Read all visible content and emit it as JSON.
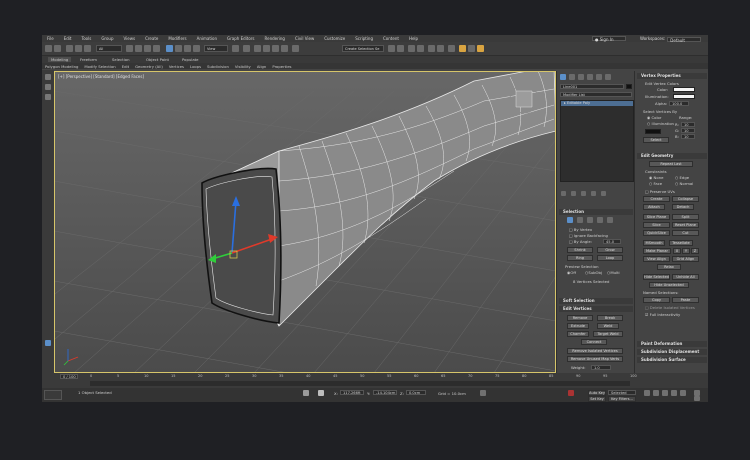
{
  "menu": [
    "File",
    "Edit",
    "Tools",
    "Group",
    "Views",
    "Create",
    "Modifiers",
    "Animation",
    "Graph Editors",
    "Rendering",
    "Civil View",
    "Customize",
    "Scripting",
    "Content",
    "Help"
  ],
  "signin": "Sign In",
  "workspaces": {
    "label": "Workspaces:",
    "value": "Default"
  },
  "toolbar": {
    "filter": "All",
    "view": "View",
    "selection_set": "Create Selection Se"
  },
  "ribbon_tabs": [
    "Modeling",
    "Freeform",
    "Selection",
    "Object Paint",
    "Populate"
  ],
  "ribbon_sub": [
    "Polygon Modeling",
    "Modify Selection",
    "Edit",
    "Geometry (All)",
    "Vertices",
    "Loops",
    "Subdivision",
    "Visibility",
    "Align",
    "Properties"
  ],
  "viewport": {
    "label": "[+] [Perspective] [Standard] [Edged Faces]"
  },
  "command_panel": {
    "object_name": "Line001",
    "modifier_list": "Modifier List",
    "modifier": "Editable Poly",
    "selection": {
      "title": "Selection",
      "by_vertex": "By Vertex",
      "ignore_backfacing": "Ignore Backfacing",
      "by_angle": "By Angle:",
      "by_angle_value": "45.0",
      "shrink": "Shrink",
      "grow": "Grow",
      "ring": "Ring",
      "loop": "Loop",
      "preview": "Preview Selection",
      "off": "Off",
      "subobj": "SubObj",
      "multi": "Multi",
      "status": "8 Vertices Selected"
    },
    "soft_selection": "Soft Selection",
    "edit_vertices": {
      "title": "Edit Vertices",
      "remove": "Remove",
      "break": "Break",
      "extrude": "Extrude",
      "weld": "Weld",
      "chamfer": "Chamfer",
      "target_weld": "Target Weld",
      "connect": "Connect",
      "remove_isolated": "Remove Isolated Vertices",
      "remove_unused": "Remove Unused Map Verts",
      "weight": "Weight:",
      "weight_value": "1.0",
      "crease": "Crease:",
      "crease_value": "0.0"
    }
  },
  "roll_panel": {
    "vertex_properties": {
      "title": "Vertex Properties",
      "edit_colors": "Edit Vertex Colors",
      "color": "Color:",
      "illumination": "Illumination:",
      "alpha": "Alpha:",
      "alpha_value": "100.0",
      "select_by": "Select Vertices By",
      "color_opt": "Color",
      "illum_opt": "Illumination",
      "range": "Range:",
      "r": "R:",
      "g": "G:",
      "b": "B:",
      "r_val": "10",
      "g_val": "10",
      "b_val": "10",
      "select": "Select"
    },
    "edit_geometry": {
      "title": "Edit Geometry",
      "repeat_last": "Repeat Last",
      "constraints": "Constraints",
      "none": "None",
      "edge": "Edge",
      "face": "Face",
      "normal": "Normal",
      "preserve_uvs": "Preserve UVs",
      "create": "Create",
      "collapse": "Collapse",
      "attach": "Attach",
      "detach": "Detach",
      "slice_plane": "Slice Plane",
      "split": "Split",
      "slice": "Slice",
      "reset_plane": "Reset Plane",
      "quickslice": "QuickSlice",
      "cut": "Cut",
      "msmooth": "MSmooth",
      "tessellate": "Tessellate",
      "make_planar": "Make Planar",
      "x": "X",
      "y": "Y",
      "z": "Z",
      "view_align": "View Align",
      "grid_align": "Grid Align",
      "relax": "Relax",
      "hide_selected": "Hide Selected",
      "unhide_all": "Unhide All",
      "hide_unselected": "Hide Unselected",
      "named_selections": "Named Selections:",
      "copy": "Copy",
      "paste": "Paste",
      "delete_isolated": "Delete Isolated Vertices",
      "full_interactivity": "Full Interactivity"
    },
    "paint_deformation": "Paint Deformation",
    "subdivision_displacement": "Subdivision Displacement",
    "subdivision_surface": "Subdivision Surface"
  },
  "timeline": {
    "frame": "0 / 100",
    "ticks": [
      "0",
      "5",
      "10",
      "15",
      "20",
      "25",
      "30",
      "35",
      "40",
      "45",
      "50",
      "55",
      "60",
      "65",
      "70",
      "75",
      "80",
      "85",
      "90",
      "95",
      "100"
    ]
  },
  "status": {
    "selected": "1 Object Selected",
    "x": "X:",
    "x_val": "117.266ft",
    "y": "Y:",
    "y_val": "-14.104cm",
    "z": "Z:",
    "z_val": "0.0cm",
    "grid": "Grid = 10.0cm",
    "auto_key": "Auto Key",
    "set_key": "Set Key",
    "selected_filter": "Selected",
    "key_filters": "Key Filters..."
  }
}
